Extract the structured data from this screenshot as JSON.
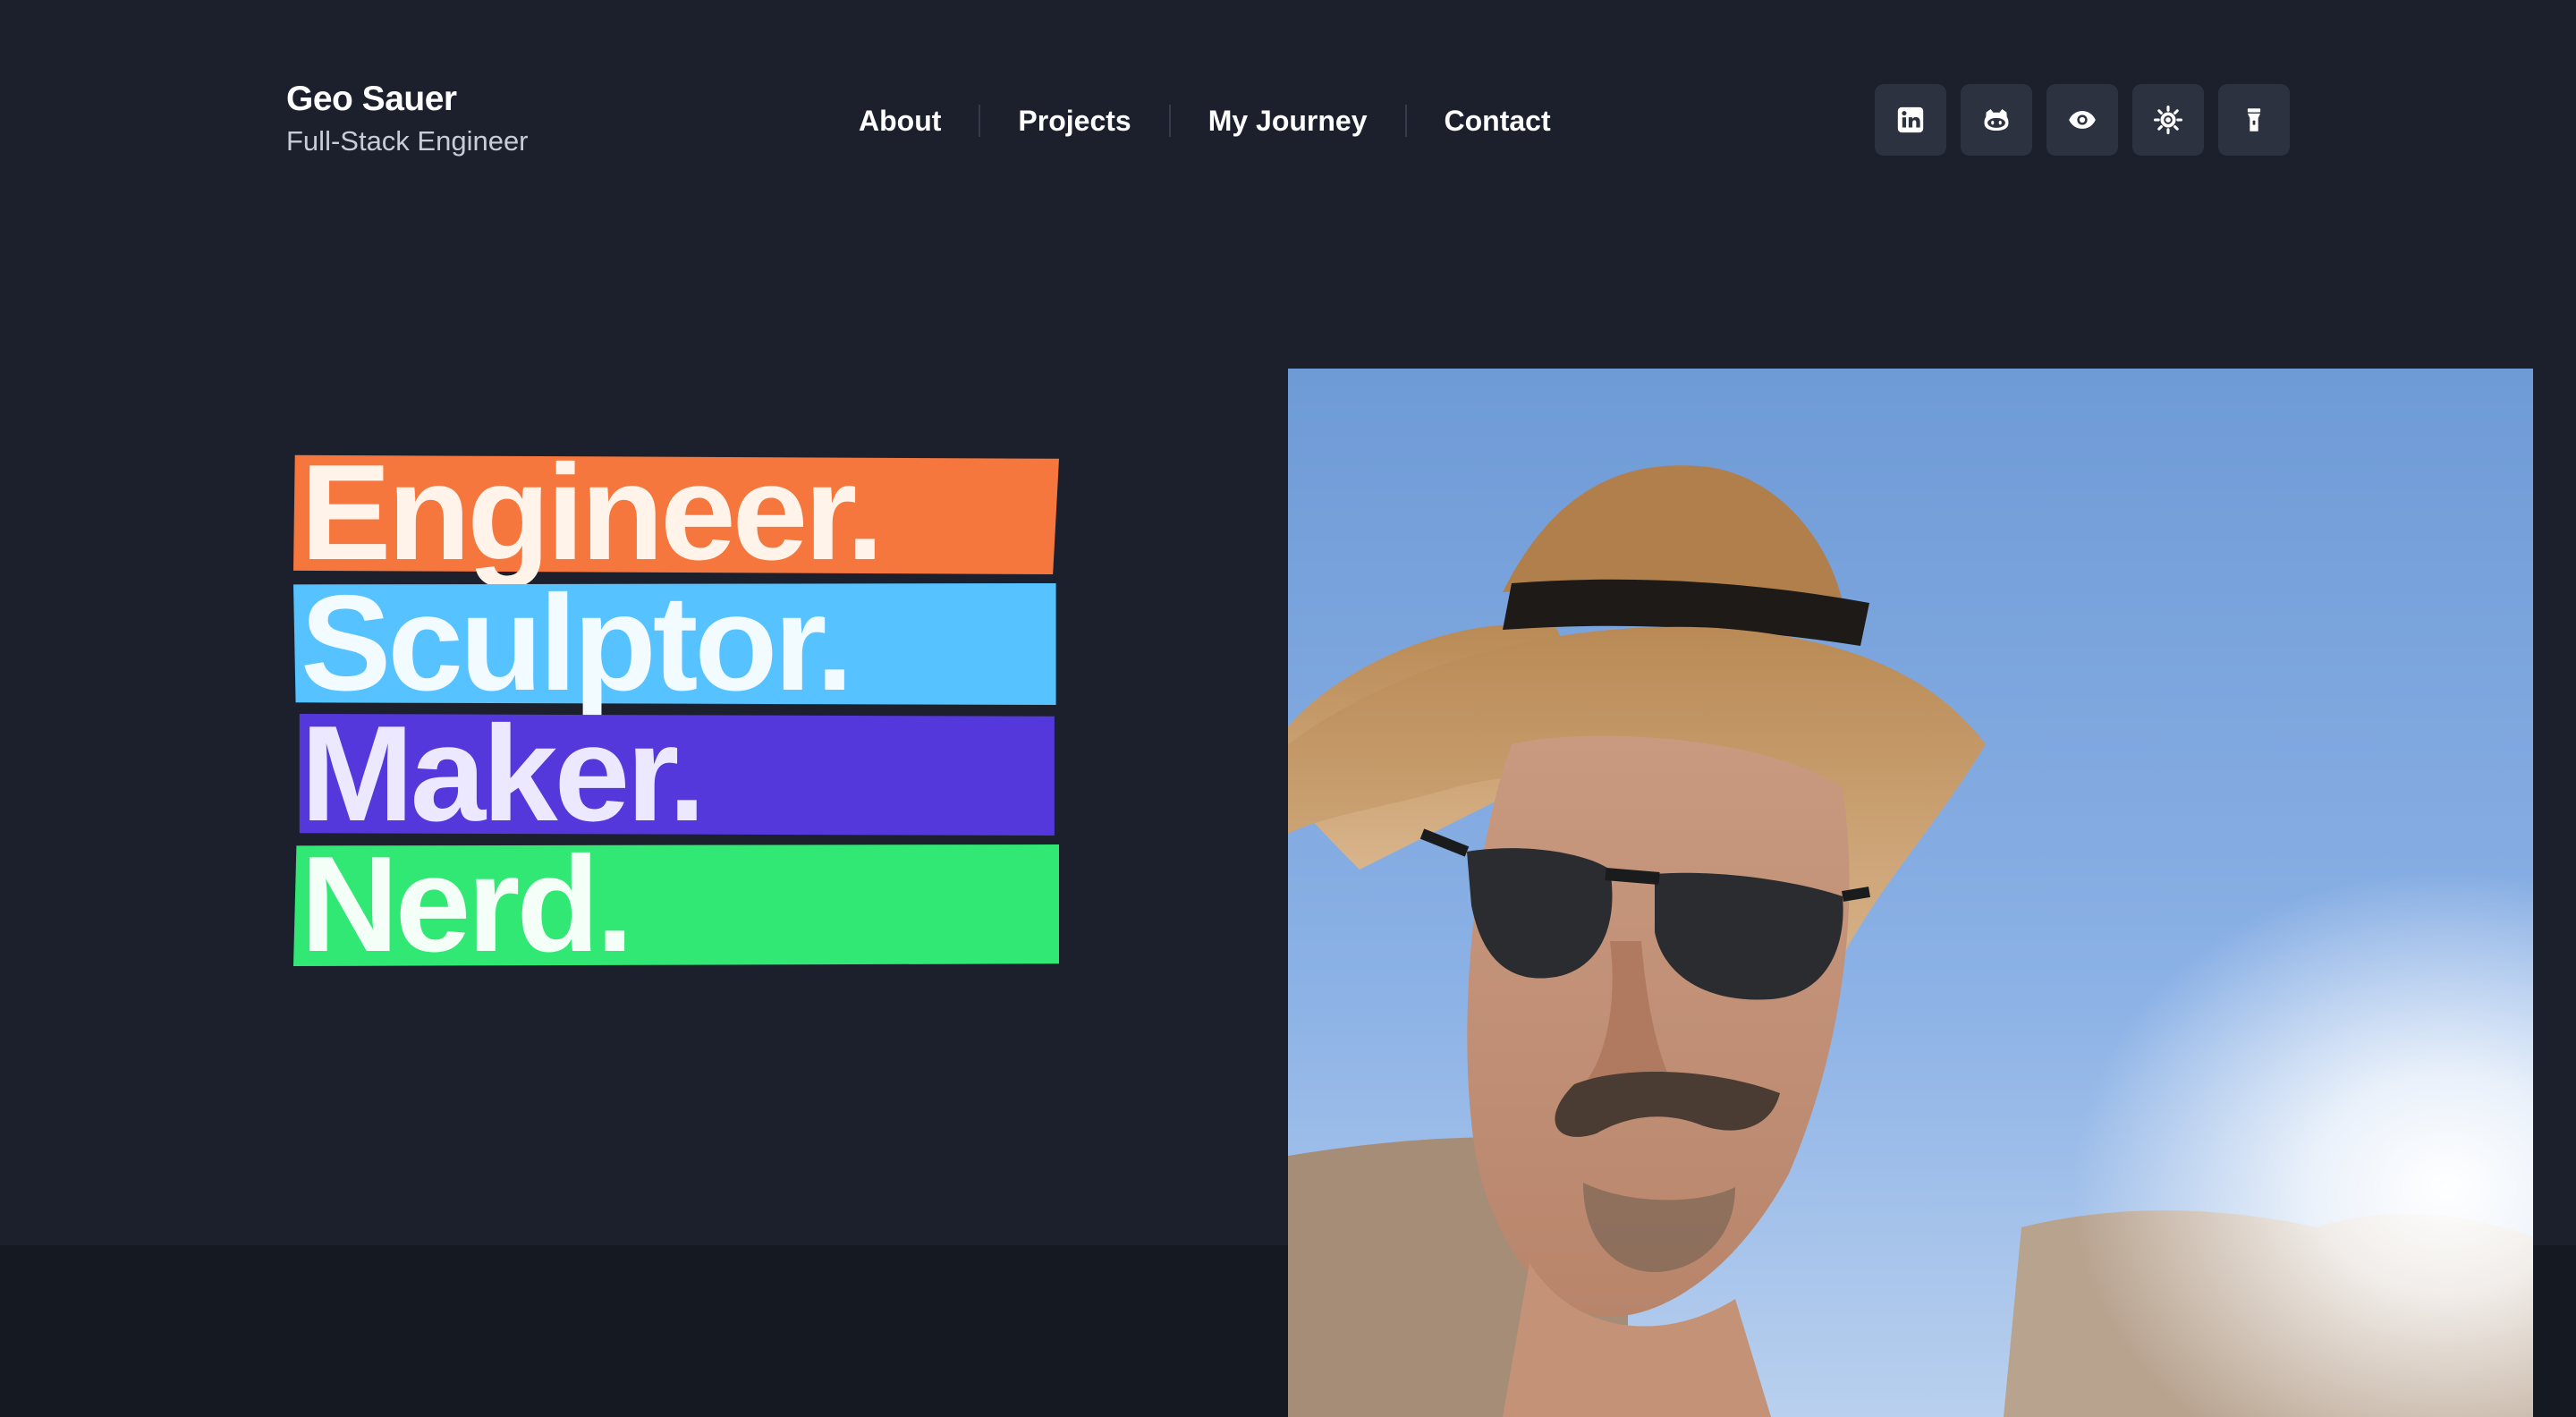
{
  "brand": {
    "name": "Geo Sauer",
    "role": "Full-Stack Engineer"
  },
  "nav": {
    "items": [
      {
        "label": "About"
      },
      {
        "label": "Projects"
      },
      {
        "label": "My Journey"
      },
      {
        "label": "Contact"
      }
    ]
  },
  "icons": [
    {
      "name": "linkedin-icon"
    },
    {
      "name": "github-icon"
    },
    {
      "name": "eye-icon"
    },
    {
      "name": "sun-icon"
    },
    {
      "name": "flashlight-icon"
    }
  ],
  "hero": {
    "words": [
      {
        "text": "Engineer.",
        "bar_color": "#f6773d",
        "text_color": "#fff3ea"
      },
      {
        "text": "Sculptor.",
        "bar_color": "#56c2ff",
        "text_color": "#f2fbff"
      },
      {
        "text": "Maker.",
        "bar_color": "#5438dc",
        "text_color": "#ece8ff"
      },
      {
        "text": "Nerd.",
        "bar_color": "#32e875",
        "text_color": "#f4fff7"
      }
    ]
  },
  "colors": {
    "background": "#1b202c",
    "bottom_band": "#151922",
    "icon_button": "#2c3240",
    "nav_separator": "#343b4a"
  }
}
